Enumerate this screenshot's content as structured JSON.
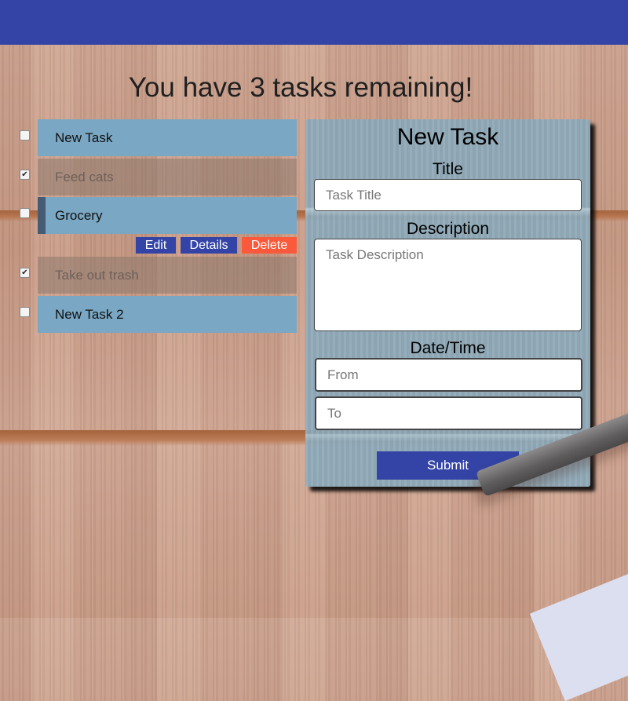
{
  "headline": "You have 3 tasks remaining!",
  "tasks": [
    {
      "title": "New Task",
      "done": false,
      "check": ""
    },
    {
      "title": "Feed cats",
      "done": true,
      "check": "✔"
    },
    {
      "title": "Grocery",
      "done": false,
      "check": ""
    },
    {
      "title": "Take out trash",
      "done": true,
      "check": "✔"
    },
    {
      "title": "New Task 2",
      "done": false,
      "check": ""
    }
  ],
  "task_actions": {
    "edit": "Edit",
    "details": "Details",
    "delete": "Delete"
  },
  "form": {
    "title": "New Task",
    "title_label": "Title",
    "title_placeholder": "Task Title",
    "description_label": "Description",
    "description_placeholder": "Task Description",
    "datetime_label": "Date/Time",
    "from_placeholder": "From",
    "to_placeholder": "To",
    "submit_label": "Submit"
  },
  "colors": {
    "primary": "#3344a6",
    "delete": "#fa5a3b",
    "task_card": "#7aa7c3"
  }
}
